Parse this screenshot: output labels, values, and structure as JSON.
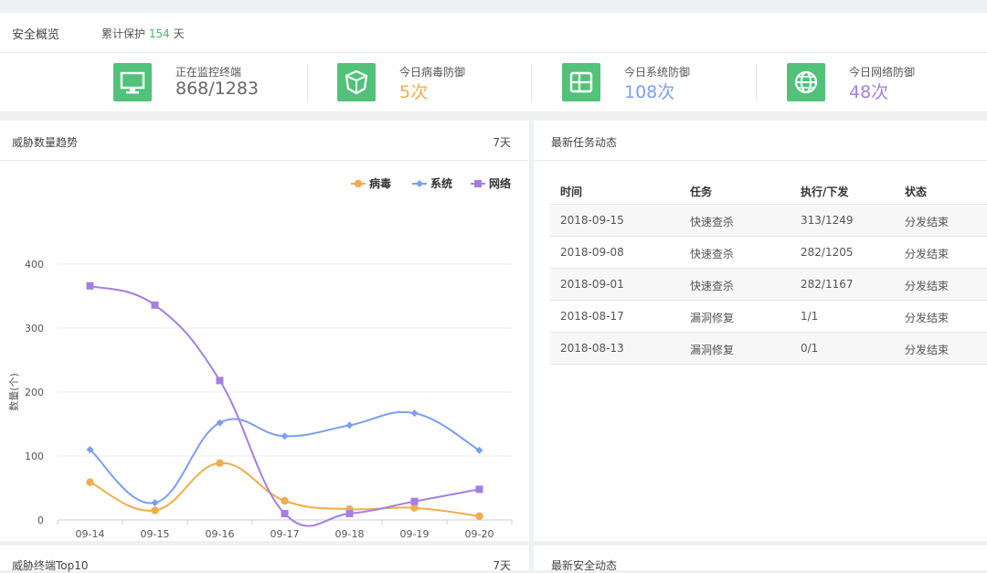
{
  "overview": {
    "title": "安全概览",
    "protect_label": "累计保护",
    "protect_days": "154",
    "protect_unit": "天",
    "stats": [
      {
        "icon": "monitor-icon",
        "label": "正在监控终端",
        "value": "868/1283",
        "color": "#666666"
      },
      {
        "icon": "shield-icon",
        "label": "今日病毒防御",
        "value": "5次",
        "color": "#f0ad4e"
      },
      {
        "icon": "windows-icon",
        "label": "今日系统防御",
        "value": "108次",
        "color": "#7b9ff0"
      },
      {
        "icon": "globe-icon",
        "label": "今日网络防御",
        "value": "48次",
        "color": "#a47fe0"
      }
    ]
  },
  "threat_panel": {
    "title": "威胁数量趋势",
    "range": "7天"
  },
  "task_panel": {
    "title": "最新任务动态",
    "headers": [
      "时间",
      "任务",
      "执行/下发",
      "状态"
    ],
    "rows": [
      [
        "2018-09-15",
        "快速查杀",
        "313/1249",
        "分发结束"
      ],
      [
        "2018-09-08",
        "快速查杀",
        "282/1205",
        "分发结束"
      ],
      [
        "2018-09-01",
        "快速查杀",
        "282/1167",
        "分发结束"
      ],
      [
        "2018-08-17",
        "漏洞修复",
        "1/1",
        "分发结束"
      ],
      [
        "2018-08-13",
        "漏洞修复",
        "0/1",
        "分发结束"
      ]
    ]
  },
  "top_panel": {
    "title": "威胁终端Top10",
    "range": "7天"
  },
  "security_panel": {
    "title": "最新安全动态"
  },
  "chart_data": {
    "type": "line",
    "categories": [
      "09-14",
      "09-15",
      "09-16",
      "09-17",
      "09-18",
      "09-19",
      "09-20"
    ],
    "ylabel": "数量(个)",
    "ylim": [
      0,
      400
    ],
    "yticks": [
      0,
      100,
      200,
      300,
      400
    ],
    "legend_position": "top-right",
    "grid": true,
    "smooth": true,
    "series": [
      {
        "name": "病毒",
        "color": "#f0ad4e",
        "marker": "circle",
        "values": [
          59,
          15,
          89,
          30,
          17,
          19,
          6
        ]
      },
      {
        "name": "系统",
        "color": "#7b9ff0",
        "marker": "diamond",
        "values": [
          110,
          27,
          152,
          131,
          148,
          167,
          109
        ]
      },
      {
        "name": "网络",
        "color": "#a47fe0",
        "marker": "square",
        "values": [
          366,
          336,
          218,
          10,
          10,
          29,
          48
        ]
      }
    ]
  }
}
